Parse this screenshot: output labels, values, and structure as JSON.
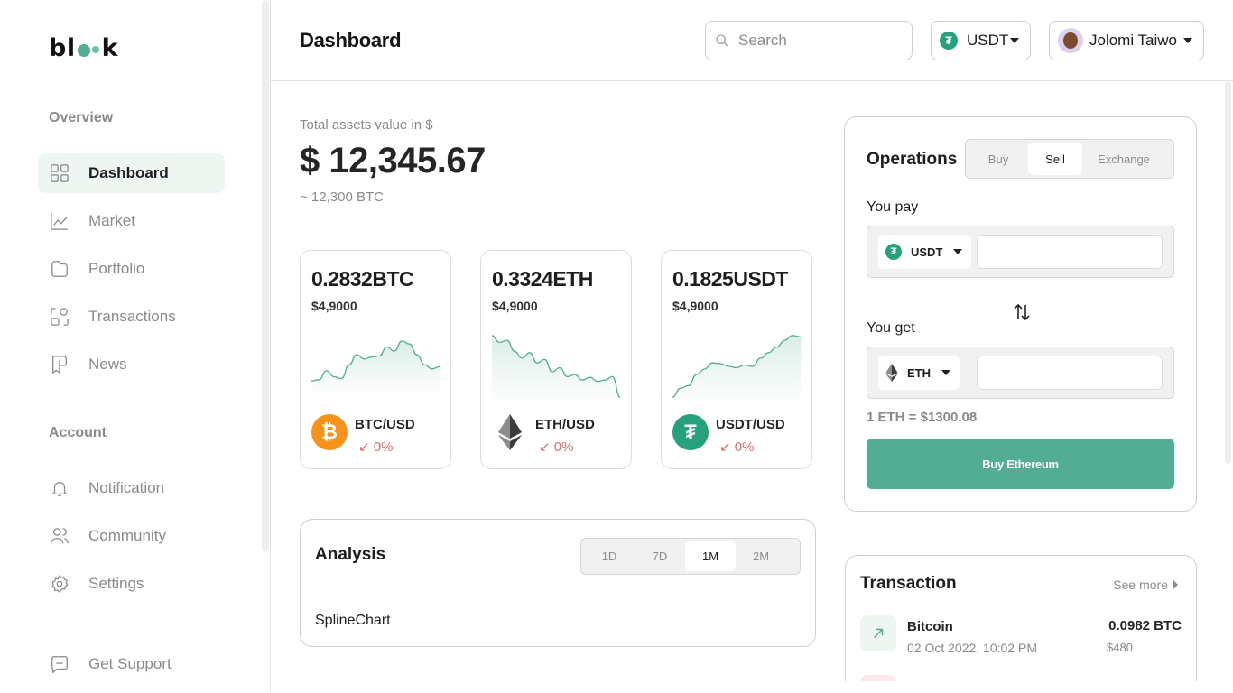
{
  "brand": {
    "logo_text_a": "bl",
    "logo_text_b": "k"
  },
  "sidebar": {
    "overview_title": "Overview",
    "account_title": "Account",
    "items": [
      {
        "label": "Dashboard",
        "icon": "grid-icon",
        "active": true
      },
      {
        "label": "Market",
        "icon": "chart-line-icon"
      },
      {
        "label": "Portfolio",
        "icon": "folder-icon"
      },
      {
        "label": "Transactions",
        "icon": "transactions-icon"
      },
      {
        "label": "News",
        "icon": "news-icon"
      }
    ],
    "account_items": [
      {
        "label": "Notification",
        "icon": "bell-icon"
      },
      {
        "label": "Community",
        "icon": "community-icon"
      },
      {
        "label": "Settings",
        "icon": "gear-icon"
      }
    ],
    "support": {
      "label": "Get Support",
      "icon": "chat-icon"
    }
  },
  "header": {
    "title": "Dashboard",
    "search_placeholder": "Search",
    "currency": "USDT",
    "user_name": "Jolomi Taiwo"
  },
  "assets": {
    "label": "Total assets value in $",
    "value": "$ 12,345.67",
    "sub": "~ 12,300 BTC"
  },
  "coins": [
    {
      "amount": "0.2832BTC",
      "usd": "$4,9000",
      "pair": "BTC/USD",
      "change": "0%",
      "color": "#f7931a",
      "spark": [
        0.18,
        0.2,
        0.35,
        0.25,
        0.22,
        0.45,
        0.62,
        0.55,
        0.58,
        0.6,
        0.75,
        0.68,
        0.85,
        0.8,
        0.62,
        0.45,
        0.38,
        0.42
      ]
    },
    {
      "amount": "0.3324ETH",
      "usd": "$4,9000",
      "pair": "ETH/USD",
      "change": "0%",
      "color": "#343434",
      "spark": [
        0.95,
        0.85,
        0.88,
        0.72,
        0.62,
        0.7,
        0.55,
        0.6,
        0.42,
        0.48,
        0.35,
        0.38,
        0.3,
        0.34,
        0.28,
        0.3,
        0.35,
        0.05
      ]
    },
    {
      "amount": "0.1825USDT",
      "usd": "$4,9000",
      "pair": "USDT/USD",
      "change": "0%",
      "color": "#26a17b",
      "spark": [
        0.05,
        0.18,
        0.22,
        0.38,
        0.46,
        0.55,
        0.54,
        0.5,
        0.48,
        0.52,
        0.5,
        0.62,
        0.7,
        0.78,
        0.88,
        0.95,
        0.93
      ]
    }
  ],
  "analysis": {
    "title": "Analysis",
    "ranges": [
      "1D",
      "7D",
      "1M",
      "2M"
    ],
    "selected_range": "1M",
    "chart_label": "SplineChart"
  },
  "operations": {
    "title": "Operations",
    "tabs": [
      "Buy",
      "Sell",
      "Exchange"
    ],
    "selected_tab": "Sell",
    "pay_label": "You pay",
    "pay_token": "USDT",
    "get_label": "You get",
    "get_token": "ETH",
    "rate": "1 ETH = $1300.08",
    "button": "Buy Ethereum"
  },
  "transactions": {
    "title": "Transaction",
    "see_more": "See more",
    "rows": [
      {
        "name": "Bitcoin",
        "date": "02 Oct 2022, 10:02 PM",
        "amount": "0.0982 BTC",
        "usd": "$480"
      }
    ]
  },
  "colors": {
    "accent": "#52ad93",
    "accent_light": "#eef6f2",
    "negative": "#e36b6b"
  }
}
